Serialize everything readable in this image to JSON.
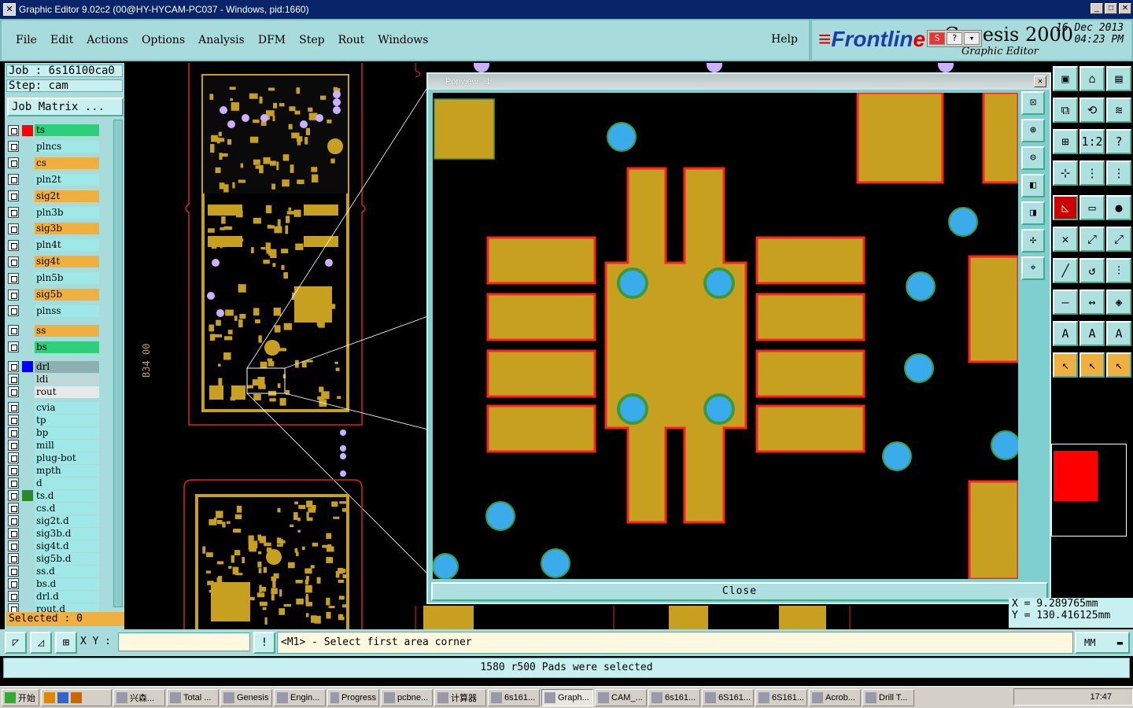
{
  "window": {
    "title": "Graphic Editor 9.02c2 (00@HY-HYCAM-PC037 - Windows, pid:1660)"
  },
  "menu": {
    "items": [
      "File",
      "Edit",
      "Actions",
      "Options",
      "Analysis",
      "DFM",
      "Step",
      "Rout",
      "Windows"
    ],
    "help": "Help"
  },
  "brand": {
    "logo_a": "Frontlin",
    "logo_b": "e",
    "product": "Genesis 2000",
    "subtitle": "Graphic Editor",
    "date": "16 Dec 2013",
    "time": "04:23 PM"
  },
  "job": {
    "job_label": "Job : 6s16100ca0",
    "step_label": "Step: cam",
    "matrix_button": "Job Matrix ..."
  },
  "layers": [
    {
      "name": "ts",
      "color": "#2ecf7a",
      "swatch": "#f00",
      "active": true
    },
    {
      "name": "plncs",
      "color": "#9fe8e8"
    },
    {
      "name": "cs",
      "color": "#f0b040"
    },
    {
      "name": "pln2t",
      "color": "#9fe8e8"
    },
    {
      "name": "sig2t",
      "color": "#f0b040"
    },
    {
      "name": "pln3b",
      "color": "#9fe8e8"
    },
    {
      "name": "sig3b",
      "color": "#f0b040"
    },
    {
      "name": "pln4t",
      "color": "#9fe8e8"
    },
    {
      "name": "sig4t",
      "color": "#f0b040"
    },
    {
      "name": "pln5b",
      "color": "#9fe8e8"
    },
    {
      "name": "sig5b",
      "color": "#f0b040"
    },
    {
      "name": "plnss",
      "color": "#9fe8e8"
    },
    {
      "name": "ss",
      "color": "#f0b040"
    },
    {
      "name": "bs",
      "color": "#2ecf7a"
    },
    {
      "name": "drl",
      "color": "#8fb0b0",
      "swatch": "#00f"
    },
    {
      "name": "ldi",
      "color": "#c0d8d8"
    },
    {
      "name": "rout",
      "color": "#e8e8e8"
    },
    {
      "name": "cvia",
      "color": "#9fe8e8"
    },
    {
      "name": "tp",
      "color": "#9fe8e8"
    },
    {
      "name": "bp",
      "color": "#9fe8e8"
    },
    {
      "name": "mill",
      "color": "#9fe8e8"
    },
    {
      "name": "plug-bot",
      "color": "#9fe8e8"
    },
    {
      "name": "mpth",
      "color": "#9fe8e8"
    },
    {
      "name": "d",
      "color": "#9fe8e8"
    },
    {
      "name": "ts.d",
      "color": "#9fe8e8",
      "swatch": "#2a8a2a"
    },
    {
      "name": "cs.d",
      "color": "#9fe8e8"
    },
    {
      "name": "sig2t.d",
      "color": "#9fe8e8"
    },
    {
      "name": "sig3b.d",
      "color": "#9fe8e8"
    },
    {
      "name": "sig4t.d",
      "color": "#9fe8e8"
    },
    {
      "name": "sig5b.d",
      "color": "#9fe8e8"
    },
    {
      "name": "ss.d",
      "color": "#9fe8e8"
    },
    {
      "name": "bs.d",
      "color": "#9fe8e8"
    },
    {
      "name": "drl.d",
      "color": "#9fe8e8"
    },
    {
      "name": "rout.d",
      "color": "#9fe8e8"
    }
  ],
  "selected_label": "Selected : 0",
  "canvas": {
    "board_text": "B34 00"
  },
  "popview": {
    "title": "Popview - 1",
    "close_label": "Close"
  },
  "coords": {
    "x": "X = 9.289765mm",
    "y": "Y = 130.416125mm"
  },
  "command": {
    "xy_label": "X Y :",
    "xy_value": "",
    "prompt": "<M1> - Select first area corner",
    "units": "MM"
  },
  "status": "1580 r500 Pads were selected",
  "taskbar": {
    "start": "开始",
    "items": [
      "兴森...",
      "Total ...",
      "Genesis",
      "Engin...",
      "Progress",
      "pcbne...",
      "计算器",
      "6s161...",
      "Graph...",
      "CAM_...",
      "6s161...",
      "6S161...",
      "6S161...",
      "Acrob...",
      "Drill T..."
    ],
    "active_index": 8,
    "clock": "17:47"
  },
  "colors": {
    "copper": "#c8a020",
    "outline": "#ff2020",
    "pad_blue": "#3aacec",
    "pad_ring": "#3a9a3a",
    "panel": "#a8dcdc"
  }
}
